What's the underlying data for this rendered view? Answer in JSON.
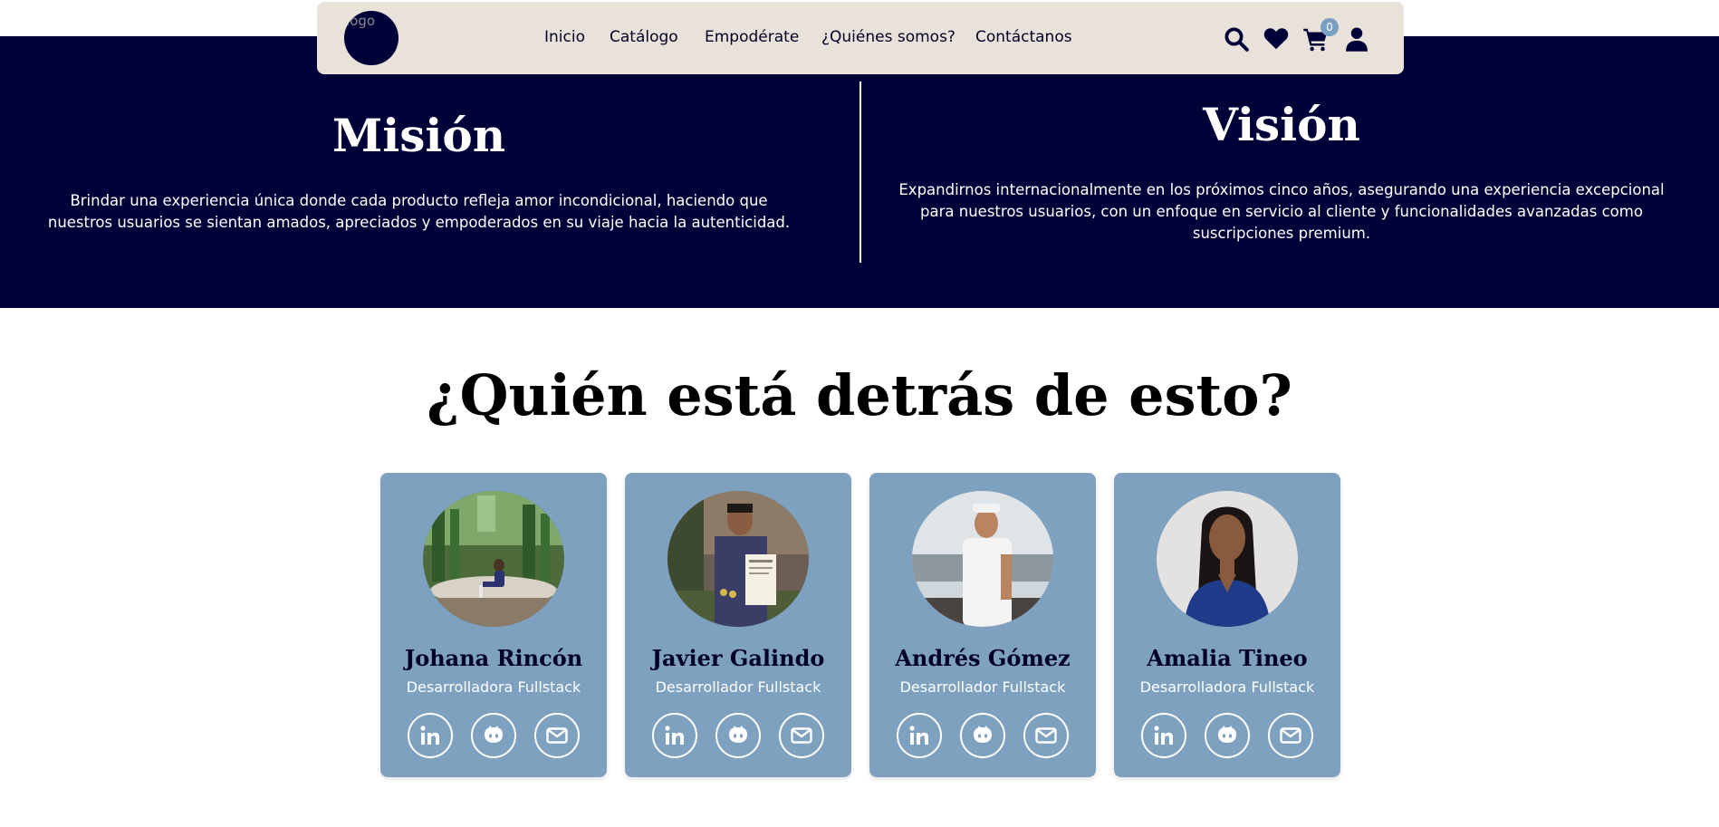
{
  "navbar": {
    "logo_alt": "logo",
    "links": [
      "Inicio",
      "Catálogo",
      "Empodérate",
      "¿Quiénes somos?",
      "Contáctanos"
    ],
    "icons": [
      "search-icon",
      "heart-icon",
      "cart-icon",
      "user-icon"
    ],
    "cart_count": "0"
  },
  "mission": {
    "title": "Misión",
    "text": "Brindar una experiencia única donde cada producto refleja amor incondicional, haciendo que nuestros usuarios se sientan amados, apreciados y empoderados en su viaje hacia la autenticidad."
  },
  "vision": {
    "title": "Visión",
    "text": "Expandirnos internacionalmente en los próximos cinco años, asegurando una experiencia excepcional para nuestros usuarios, con un enfoque en servicio al cliente y funcionalidades avanzadas como suscripciones premium."
  },
  "team": {
    "title": "¿Quién está detrás de esto?",
    "members": [
      {
        "name": "Johana Rincón",
        "role": "Desarrolladora Fullstack"
      },
      {
        "name": "Javier Galindo",
        "role": "Desarrollador Fullstack"
      },
      {
        "name": "Andrés Gómez",
        "role": "Desarrollador Fullstack"
      },
      {
        "name": "Amalia Tineo",
        "role": "Desarrolladora Fullstack"
      }
    ],
    "social_icons": [
      "linkedin-icon",
      "github-icon",
      "email-icon"
    ]
  },
  "colors": {
    "navy": "#000038",
    "navbar_bg": "#e8e2da",
    "card_bg": "#7ea1c0",
    "badge": "#7aa0c2"
  }
}
